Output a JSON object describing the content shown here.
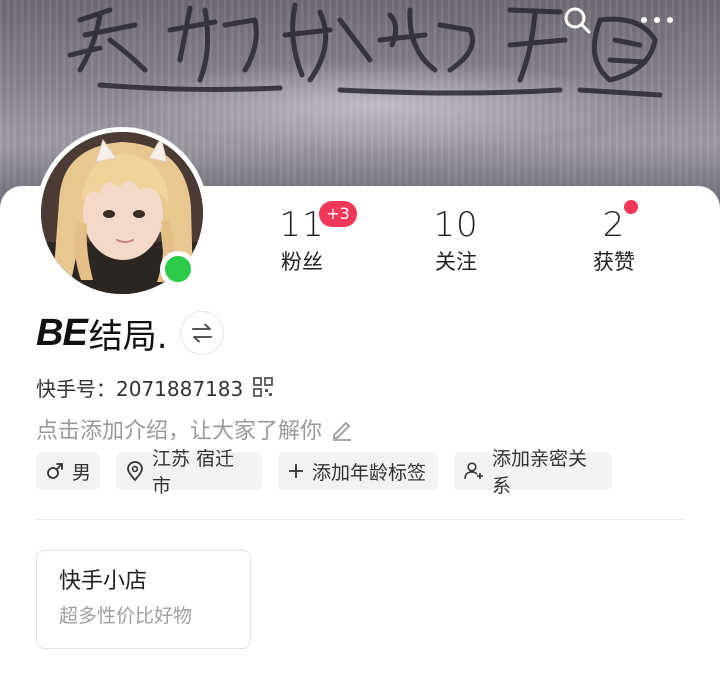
{
  "header": {
    "graffiti_text": "来你妈个逼",
    "search_icon": "search-icon",
    "more_icon": "more-dots-icon"
  },
  "profile": {
    "avatar_icon": "avatar",
    "online_status_color": "#2ecb4a",
    "name_prefix": "BE",
    "name_suffix": "结局.",
    "switch_icon": "switch-arrows-icon",
    "kuaishou_id": "快手号：2071887183",
    "intro_placeholder": "点击添加介绍，让大家了解你"
  },
  "stats": {
    "fans_count": "11",
    "fans_badge": "+3",
    "fans_label": "粉丝",
    "following_count": "10",
    "following_label": "关注",
    "likes_count": "2",
    "likes_label": "获赞",
    "accent_color": "#f0385a"
  },
  "tags": {
    "gender": "男",
    "location": "江苏 宿迁市",
    "add_age": "添加年龄标签",
    "add_relation": "添加亲密关系"
  },
  "shop": {
    "title": "快手小店",
    "subtitle": "超多性价比好物"
  }
}
